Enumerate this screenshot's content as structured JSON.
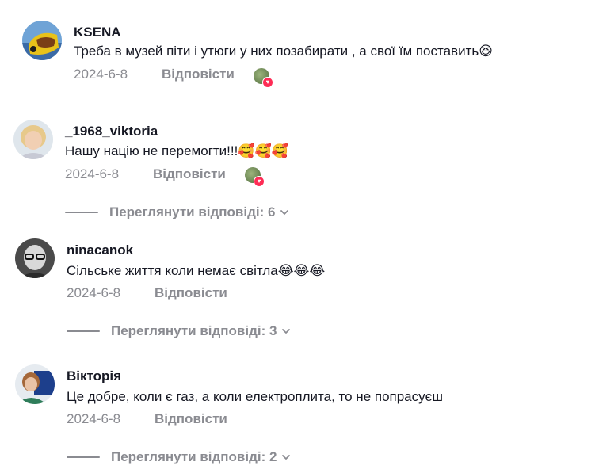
{
  "comments": [
    {
      "username": "KSENA",
      "text": "Треба в музей піти і утюги у них позабирати , а свої їм поставить",
      "emoji": "😆",
      "date": "2024-6-8",
      "reply_label": "Відповісти",
      "avatar_icon": "ksena-avatar"
    },
    {
      "username": "_1968_viktoria",
      "text": "Нашу націю не перемогти!!!",
      "emoji": "🥰🥰🥰",
      "date": "2024-6-8",
      "reply_label": "Відповісти",
      "view_replies": "Переглянути відповіді: 6",
      "avatar_icon": "viktoria-avatar"
    },
    {
      "username": "ninacanok",
      "text": "Сільське життя коли немає світла",
      "emoji": "😂😂😂",
      "date": "2024-6-8",
      "reply_label": "Відповісти",
      "view_replies": "Переглянути відповіді: 3",
      "avatar_icon": "ninacanok-avatar"
    },
    {
      "username": "Вікторія",
      "text": "Це добре, коли є газ, а коли електроплита, то не попрасуєш",
      "date": "2024-6-8",
      "reply_label": "Відповісти",
      "view_replies": "Переглянути відповіді: 2",
      "avatar_icon": "viktoriia-avatar"
    }
  ],
  "colors": {
    "primary_text": "#161823",
    "secondary_text": "#8a8b91",
    "heart": "#fe2c55"
  }
}
